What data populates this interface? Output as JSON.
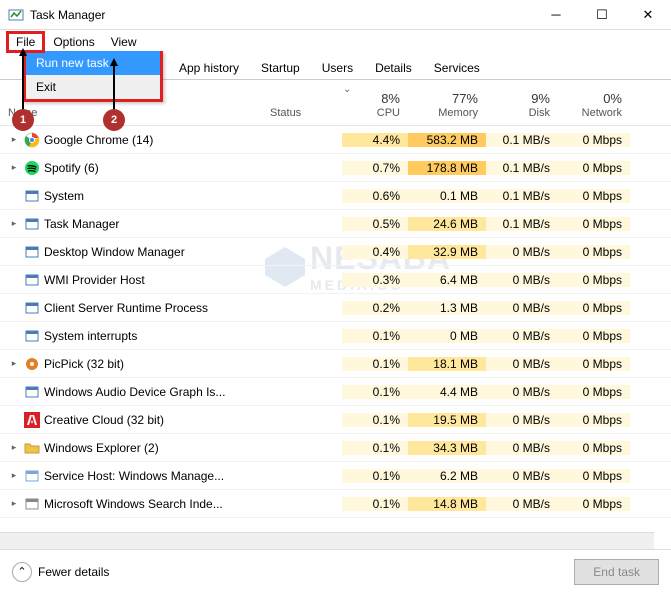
{
  "window": {
    "title": "Task Manager"
  },
  "menubar": {
    "file": "File",
    "options": "Options",
    "view": "View"
  },
  "dropdown": {
    "run": "Run new task",
    "exit": "Exit"
  },
  "tabs": [
    "App history",
    "Startup",
    "Users",
    "Details",
    "Services"
  ],
  "columns": {
    "name": "Name",
    "status": "Status",
    "cpu": {
      "pct": "8%",
      "label": "CPU"
    },
    "memory": {
      "pct": "77%",
      "label": "Memory"
    },
    "disk": {
      "pct": "9%",
      "label": "Disk"
    },
    "network": {
      "pct": "0%",
      "label": "Network"
    }
  },
  "processes": [
    {
      "name": "Google Chrome (14)",
      "icon": "chrome",
      "expand": true,
      "cpu": "4.4%",
      "mem": "583.2 MB",
      "disk": "0.1 MB/s",
      "net": "0 Mbps",
      "heat": {
        "cpu": "mid",
        "mem": "high",
        "disk": "low",
        "net": "low"
      }
    },
    {
      "name": "Spotify (6)",
      "icon": "spotify",
      "expand": true,
      "cpu": "0.7%",
      "mem": "178.8 MB",
      "disk": "0.1 MB/s",
      "net": "0 Mbps",
      "heat": {
        "cpu": "low",
        "mem": "high",
        "disk": "low",
        "net": "low"
      }
    },
    {
      "name": "System",
      "icon": "system",
      "expand": false,
      "cpu": "0.6%",
      "mem": "0.1 MB",
      "disk": "0.1 MB/s",
      "net": "0 Mbps",
      "heat": {
        "cpu": "low",
        "mem": "low",
        "disk": "low",
        "net": "low"
      }
    },
    {
      "name": "Task Manager",
      "icon": "taskmgr",
      "expand": true,
      "cpu": "0.5%",
      "mem": "24.6 MB",
      "disk": "0.1 MB/s",
      "net": "0 Mbps",
      "heat": {
        "cpu": "low",
        "mem": "mid",
        "disk": "low",
        "net": "low"
      }
    },
    {
      "name": "Desktop Window Manager",
      "icon": "dwm",
      "expand": false,
      "cpu": "0.4%",
      "mem": "32.9 MB",
      "disk": "0 MB/s",
      "net": "0 Mbps",
      "heat": {
        "cpu": "low",
        "mem": "mid",
        "disk": "low",
        "net": "low"
      }
    },
    {
      "name": "WMI Provider Host",
      "icon": "wmi",
      "expand": false,
      "cpu": "0.3%",
      "mem": "6.4 MB",
      "disk": "0 MB/s",
      "net": "0 Mbps",
      "heat": {
        "cpu": "low",
        "mem": "low",
        "disk": "low",
        "net": "low"
      }
    },
    {
      "name": "Client Server Runtime Process",
      "icon": "csrss",
      "expand": false,
      "cpu": "0.2%",
      "mem": "1.3 MB",
      "disk": "0 MB/s",
      "net": "0 Mbps",
      "heat": {
        "cpu": "low",
        "mem": "low",
        "disk": "low",
        "net": "low"
      }
    },
    {
      "name": "System interrupts",
      "icon": "sysint",
      "expand": false,
      "cpu": "0.1%",
      "mem": "0 MB",
      "disk": "0 MB/s",
      "net": "0 Mbps",
      "heat": {
        "cpu": "low",
        "mem": "low",
        "disk": "low",
        "net": "low"
      }
    },
    {
      "name": "PicPick (32 bit)",
      "icon": "picpick",
      "expand": true,
      "cpu": "0.1%",
      "mem": "18.1 MB",
      "disk": "0 MB/s",
      "net": "0 Mbps",
      "heat": {
        "cpu": "low",
        "mem": "mid",
        "disk": "low",
        "net": "low"
      }
    },
    {
      "name": "Windows Audio Device Graph Is...",
      "icon": "audio",
      "expand": false,
      "cpu": "0.1%",
      "mem": "4.4 MB",
      "disk": "0 MB/s",
      "net": "0 Mbps",
      "heat": {
        "cpu": "low",
        "mem": "low",
        "disk": "low",
        "net": "low"
      }
    },
    {
      "name": "Creative Cloud (32 bit)",
      "icon": "adobe",
      "expand": false,
      "cpu": "0.1%",
      "mem": "19.5 MB",
      "disk": "0 MB/s",
      "net": "0 Mbps",
      "heat": {
        "cpu": "low",
        "mem": "mid",
        "disk": "low",
        "net": "low"
      }
    },
    {
      "name": "Windows Explorer (2)",
      "icon": "explorer",
      "expand": true,
      "cpu": "0.1%",
      "mem": "34.3 MB",
      "disk": "0 MB/s",
      "net": "0 Mbps",
      "heat": {
        "cpu": "low",
        "mem": "mid",
        "disk": "low",
        "net": "low"
      }
    },
    {
      "name": "Service Host: Windows Manage...",
      "icon": "svchost",
      "expand": true,
      "cpu": "0.1%",
      "mem": "6.2 MB",
      "disk": "0 MB/s",
      "net": "0 Mbps",
      "heat": {
        "cpu": "low",
        "mem": "low",
        "disk": "low",
        "net": "low"
      }
    },
    {
      "name": "Microsoft Windows Search Inde...",
      "icon": "search",
      "expand": true,
      "cpu": "0.1%",
      "mem": "14.8 MB",
      "disk": "0 MB/s",
      "net": "0 Mbps",
      "heat": {
        "cpu": "low",
        "mem": "mid",
        "disk": "low",
        "net": "low"
      }
    }
  ],
  "footer": {
    "fewer": "Fewer details",
    "endtask": "End task"
  },
  "annotations": {
    "b1": "1",
    "b2": "2"
  },
  "watermark": "NESABA",
  "watermark2": "MEDIA.CO",
  "icons": {
    "chrome": "#4285f4",
    "spotify": "#1ed760",
    "system": "#4a7cb8",
    "taskmgr": "#4a7cb8",
    "dwm": "#4a7cb8",
    "wmi": "#4a7cb8",
    "csrss": "#4a7cb8",
    "sysint": "#4a7cb8",
    "picpick": "#e67e22",
    "audio": "#4a7cb8",
    "adobe": "#da1f26",
    "explorer": "#f0c14b",
    "svchost": "#7aa8d4",
    "search": "#888"
  }
}
